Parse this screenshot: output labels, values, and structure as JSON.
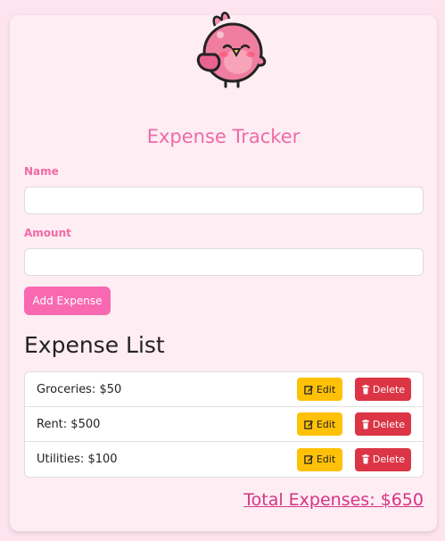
{
  "app": {
    "title": "Expense Tracker"
  },
  "form": {
    "name_label": "Name",
    "name_value": "",
    "amount_label": "Amount",
    "amount_value": "",
    "add_button_label": "Add Expense"
  },
  "list": {
    "heading": "Expense List",
    "items": [
      {
        "label": "Groceries: $50",
        "edit_label": "Edit",
        "delete_label": "Delete"
      },
      {
        "label": "Rent: $500",
        "edit_label": "Edit",
        "delete_label": "Delete"
      },
      {
        "label": "Utilities: $100",
        "edit_label": "Edit",
        "delete_label": "Delete"
      }
    ]
  },
  "summary": {
    "total_text": "Total Expenses: $650"
  },
  "icons": {
    "mascot": "pink-bird-mascot",
    "edit": "edit-icon",
    "delete": "trash-icon"
  },
  "colors": {
    "page_background": "#fde4ee",
    "card_background": "#feedf3",
    "accent_pink": "#f06aa7",
    "button_pink": "#f869b1",
    "edit_yellow": "#ffc107",
    "delete_red": "#dc3545",
    "total_pink": "#d63384"
  }
}
